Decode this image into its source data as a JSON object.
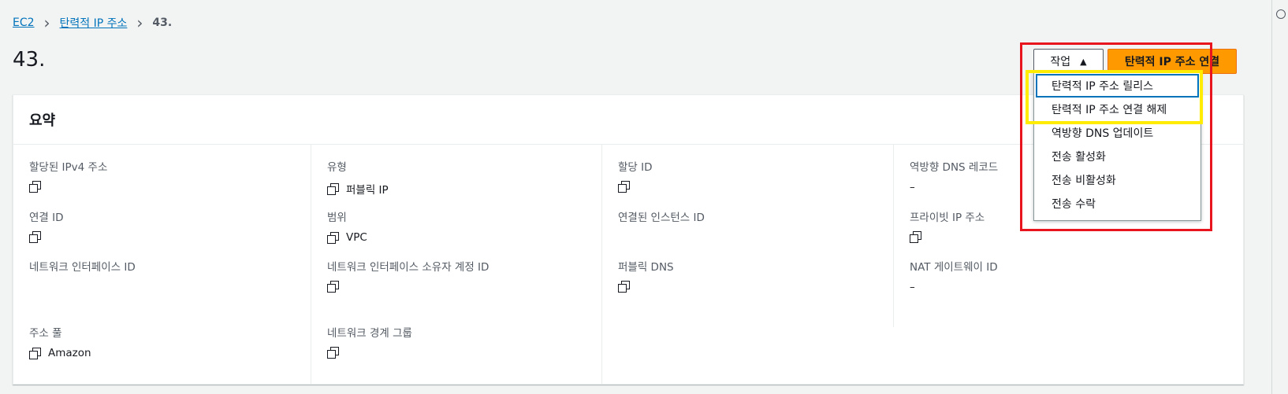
{
  "breadcrumb": {
    "items": [
      "EC2",
      "탄력적 IP 주소"
    ],
    "current": "43."
  },
  "page_title": "43.",
  "buttons": {
    "actions_label": "작업",
    "primary_label": "탄력적 IP 주소 연결"
  },
  "dropdown": {
    "items": [
      "탄력적 IP 주소 릴리스",
      "탄력적 IP 주소 연결 해제",
      "역방향 DNS 업데이트",
      "전송 활성화",
      "전송 비활성화",
      "전송 수락"
    ]
  },
  "summary": {
    "title": "요약",
    "col1": [
      {
        "label": "할당된 IPv4 주소",
        "value": ""
      },
      {
        "label": "연결 ID",
        "value": ""
      },
      {
        "label": "네트워크 인터페이스 ID",
        "value": ""
      },
      {
        "label": "주소 풀",
        "value": "Amazon"
      }
    ],
    "col2": [
      {
        "label": "유형",
        "value": "퍼블릭 IP"
      },
      {
        "label": "범위",
        "value": "VPC"
      },
      {
        "label": "네트워크 인터페이스 소유자 계정 ID",
        "value": ""
      },
      {
        "label": "네트워크 경계 그룹",
        "value": ""
      }
    ],
    "col3": [
      {
        "label": "할당 ID",
        "value": ""
      },
      {
        "label": "연결된 인스턴스 ID",
        "value": ""
      },
      {
        "label": "퍼블릭 DNS",
        "value": ""
      }
    ],
    "col4": [
      {
        "label": "역방향 DNS 레코드",
        "value": "–"
      },
      {
        "label": "프라이빗 IP 주소",
        "value": ""
      },
      {
        "label": "NAT 게이트웨이 ID",
        "value": "–"
      }
    ]
  },
  "colors": {
    "highlight_red": "#e8141e",
    "highlight_yellow": "#ffec00",
    "primary": "#ff9900",
    "link": "#0073bb"
  }
}
